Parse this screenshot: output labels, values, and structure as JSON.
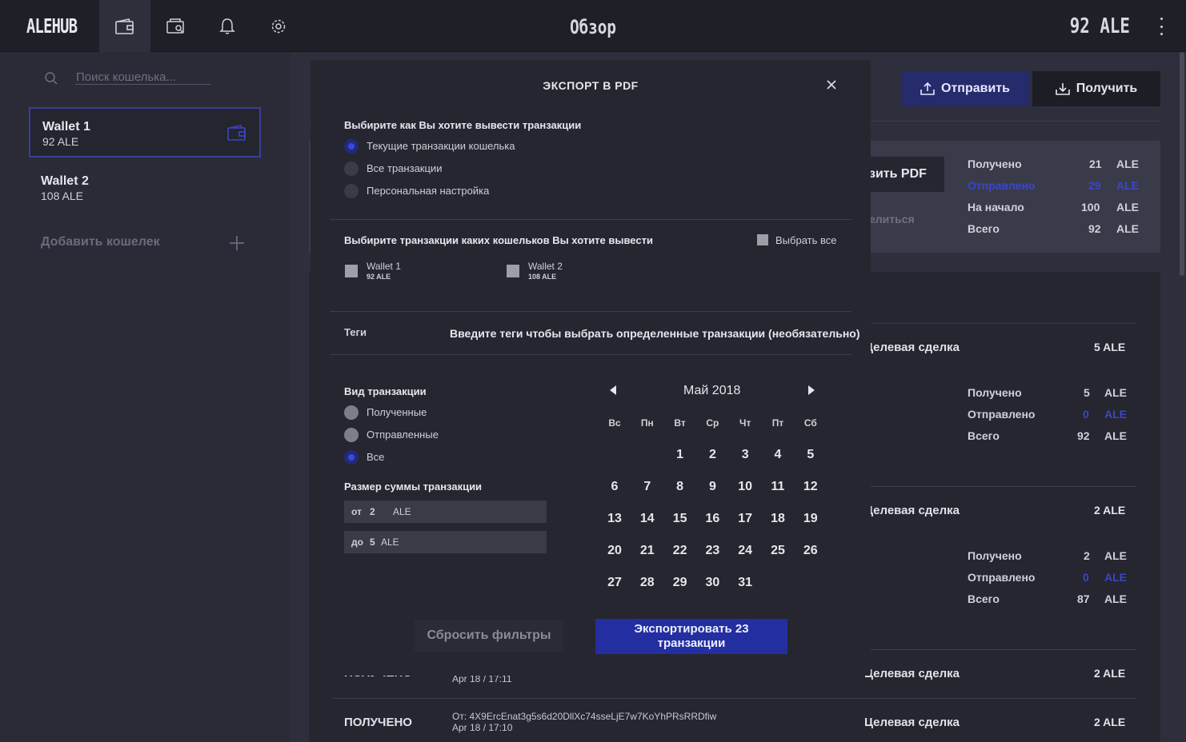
{
  "app": {
    "logo": "ALEHUB",
    "title": "Обзор",
    "balance": "92 ALE"
  },
  "topbar": {
    "icons": [
      "wallet-icon",
      "wallet-search-icon",
      "bell-icon",
      "gear-icon"
    ],
    "menu_icon": "kebab-menu-icon"
  },
  "sidebar": {
    "search_placeholder": "Поиск кошелька...",
    "wallets": [
      {
        "name": "Wallet 1",
        "balance": "92 ALE"
      },
      {
        "name": "Wallet 2",
        "balance": "108 ALE"
      }
    ],
    "add_wallet": "Добавить кошелек"
  },
  "actions": {
    "send": "Отправить",
    "receive": "Получить"
  },
  "summary": {
    "export_pdf": "зить PDF",
    "share": "елиться",
    "rows": [
      {
        "label": "Получено",
        "value": "21",
        "unit": "ALE"
      },
      {
        "label": "Отправлено",
        "value": "29",
        "unit": "ALE"
      },
      {
        "label": "На начало",
        "value": "100",
        "unit": "ALE"
      },
      {
        "label": "Всего",
        "value": "92",
        "unit": "ALE"
      }
    ]
  },
  "transactions": [
    {
      "tag": "Целевая сделка",
      "amount": "5 ALE",
      "stats": [
        {
          "label": "Получено",
          "value": "5",
          "unit": "ALE"
        },
        {
          "label": "Отправлено",
          "value": "0",
          "unit": "ALE"
        },
        {
          "label": "Всего",
          "value": "92",
          "unit": "ALE"
        }
      ]
    },
    {
      "tag": "Целевая сделка",
      "amount": "2 ALE",
      "stats": [
        {
          "label": "Получено",
          "value": "2",
          "unit": "ALE"
        },
        {
          "label": "Отправлено",
          "value": "0",
          "unit": "ALE"
        },
        {
          "label": "Всего",
          "value": "87",
          "unit": "ALE"
        }
      ]
    },
    {
      "type": "ПОЛУЧЕНО",
      "date": "Apr 18 / 17:11",
      "tag": "Целевая сделка",
      "amount": "2 ALE"
    },
    {
      "type": "ПОЛУЧЕНО",
      "from": "От: 4X9ErcEnat3g5s6d20DllXc74sseLjE7w7KoYhPRsRRDfiw",
      "date": "Apr 18 / 17:10",
      "tag": "Целевая сделка",
      "amount": "2 ALE"
    }
  ],
  "modal": {
    "title": "ЭКСПОРТ В PDF",
    "output_heading": "Выбирите как Вы хотите вывести транзакции",
    "output_options": [
      "Текущие транзакции кошелька",
      "Все транзакции",
      "Персональная настройка"
    ],
    "wallets_heading": "Выбирите транзакции каких кошельков Вы хотите вывести",
    "select_all": "Выбрать все",
    "wallets": [
      {
        "name": "Wallet 1",
        "balance": "92  ALE"
      },
      {
        "name": "Wallet 2",
        "balance": "108  ALE"
      }
    ],
    "tags_label": "Теги",
    "tags_placeholder": "Введите теги чтобы выбрать определенные транзакции (необязательно)",
    "type_heading": "Вид транзакции",
    "type_options": [
      "Полученные",
      "Отправленные",
      "Все"
    ],
    "amount_heading": "Размер суммы транзакции",
    "amount_from": {
      "prefix": "от",
      "value": "2",
      "unit": "ALE"
    },
    "amount_to": {
      "prefix": "до",
      "value": "5",
      "unit": "ALE"
    },
    "calendar": {
      "month": "Май 2018",
      "weekdays": [
        "Вс",
        "Пн",
        "Вт",
        "Ср",
        "Чт",
        "Пт",
        "Сб"
      ],
      "weeks": [
        [
          "",
          "",
          "1",
          "2",
          "3",
          "4",
          "5"
        ],
        [
          "6",
          "7",
          "8",
          "9",
          "10",
          "11",
          "12"
        ],
        [
          "13",
          "14",
          "15",
          "16",
          "17",
          "18",
          "19"
        ],
        [
          "20",
          "21",
          "22",
          "23",
          "24",
          "25",
          "26"
        ],
        [
          "27",
          "28",
          "29",
          "30",
          "31",
          "",
          ""
        ]
      ]
    },
    "reset": "Сбросить фильтры",
    "export": "Экспортировать 23 транзакции"
  },
  "colors": {
    "accent": "#232ea0",
    "link_blue": "#3a46c8",
    "bg": "#2e2f3c"
  }
}
